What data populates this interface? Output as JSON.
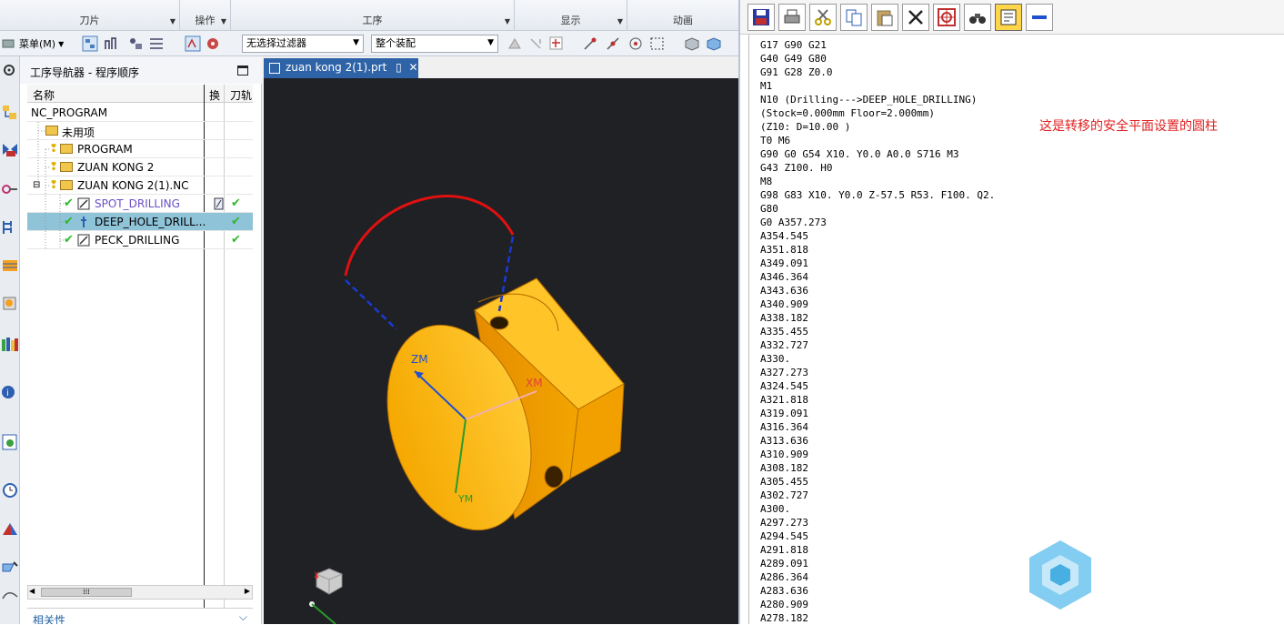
{
  "ribbon": {
    "groups": [
      "刀片",
      "操作",
      "工序",
      "显示",
      "动画"
    ]
  },
  "toolbar": {
    "menu_label": "菜单(M)",
    "filter_combo": "无选择过滤器",
    "assembly_combo": "整个装配"
  },
  "navigator": {
    "title": "工序导航器 - 程序顺序",
    "columns": {
      "name": "名称",
      "change": "换",
      "path": "刀轨"
    },
    "rows": [
      {
        "label": "NC_PROGRAM"
      },
      {
        "label": "未用项"
      },
      {
        "label": "PROGRAM"
      },
      {
        "label": "ZUAN KONG 2"
      },
      {
        "label": "ZUAN KONG 2(1).NC"
      },
      {
        "label": "SPOT_DRILLING"
      },
      {
        "label": "DEEP_HOLE_DRILL..."
      },
      {
        "label": "PECK_DRILLING"
      }
    ],
    "related_label": "相关性"
  },
  "viewport": {
    "tab_label": "zuan kong 2(1).prt",
    "axis_labels": {
      "zm": "ZM",
      "xm": "XM",
      "ym": "YM"
    },
    "triad_labels": {
      "x": "X",
      "y": "Y"
    }
  },
  "editor": {
    "code_lines": [
      "G17 G90 G21",
      "G40 G49 G80",
      "G91 G28 Z0.0",
      "M1",
      "N10 (Drilling--->DEEP_HOLE_DRILLING)",
      "(Stock=0.000mm Floor=2.000mm)",
      "(Z10: D=10.00 )",
      "T0 M6",
      "G90 G0 G54 X10. Y0.0 A0.0 S716 M3",
      "G43 Z100. H0",
      "M8",
      "G98 G83 X10. Y0.0 Z-57.5 R53. F100. Q2.",
      "G80",
      "G0 A357.273",
      "A354.545",
      "A351.818",
      "A349.091",
      "A346.364",
      "A343.636",
      "A340.909",
      "A338.182",
      "A335.455",
      "A332.727",
      "A330.",
      "A327.273",
      "A324.545",
      "A321.818",
      "A319.091",
      "A316.364",
      "A313.636",
      "A310.909",
      "A308.182",
      "A305.455",
      "A302.727",
      "A300.",
      "A297.273",
      "A294.545",
      "A291.818",
      "A289.091",
      "A286.364",
      "A283.636",
      "A280.909",
      "A278.182"
    ],
    "annotation": "这是转移的安全平面设置的圆柱"
  },
  "colors": {
    "accent": "#2e63a8",
    "part": "#f5a800",
    "annotation": "#e02020",
    "toolpath": "#e01010"
  }
}
